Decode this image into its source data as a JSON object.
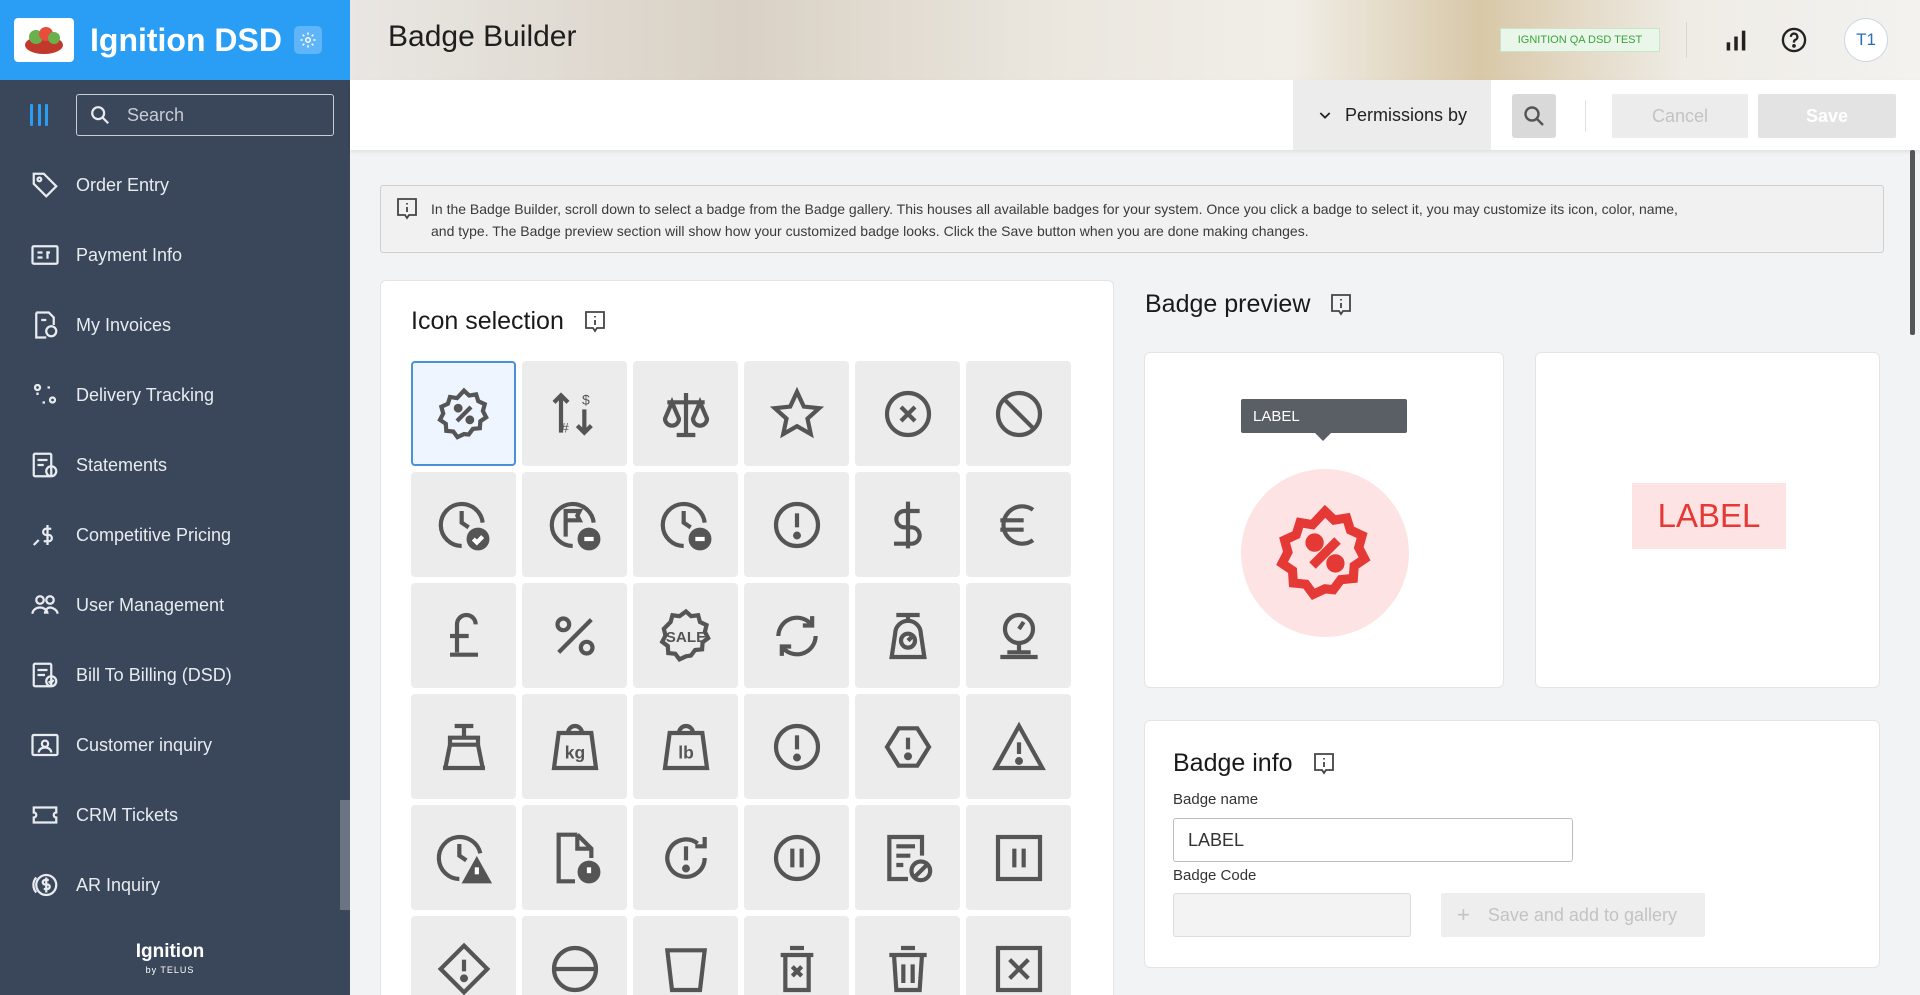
{
  "app": {
    "name": "Ignition DSD",
    "footer_brand": "Ignition",
    "footer_sub": "by TELUS"
  },
  "sidebar": {
    "search_placeholder": "Search",
    "items": [
      {
        "label": "Order Entry",
        "icon": "tag-icon"
      },
      {
        "label": "Payment Info",
        "icon": "payment-card-icon"
      },
      {
        "label": "My Invoices",
        "icon": "invoice-icon"
      },
      {
        "label": "Delivery Tracking",
        "icon": "route-pin-icon"
      },
      {
        "label": "Statements",
        "icon": "statement-icon"
      },
      {
        "label": "Competitive Pricing",
        "icon": "dollar-trend-icon"
      },
      {
        "label": "User Management",
        "icon": "users-icon"
      },
      {
        "label": "Bill To Billing (DSD)",
        "icon": "bill-check-icon"
      },
      {
        "label": "Customer inquiry",
        "icon": "customer-card-icon"
      },
      {
        "label": "CRM Tickets",
        "icon": "ticket-icon"
      },
      {
        "label": "AR Inquiry",
        "icon": "coin-icon"
      }
    ]
  },
  "header": {
    "title": "Badge Builder",
    "env_badge": "IGNITION QA DSD TEST",
    "avatar_initials": "T1"
  },
  "toolbar": {
    "permissions_label": "Permissions by",
    "cancel_label": "Cancel",
    "save_label": "Save"
  },
  "info_banner": {
    "line1": "In the Badge Builder, scroll down to select a badge from the Badge gallery. This houses all available badges for your system. Once you click a badge to select it, you may customize its icon, color, name,",
    "line2": "and type. The Badge preview section will show how your customized badge looks. Click the Save button when you are done making changes."
  },
  "icon_selection": {
    "title": "Icon selection",
    "icons": [
      "percent-badge-icon",
      "sort-price-icon",
      "scale-balance-icon",
      "star-icon",
      "circle-x-icon",
      "ban-icon",
      "clock-check-icon",
      "flag-minus-icon",
      "clock-minus-icon",
      "alert-circle-icon",
      "dollar-icon",
      "euro-icon",
      "pound-icon",
      "percent-icon",
      "sale-icon",
      "refresh-icon",
      "kitchen-scale-icon",
      "balance-scale-icon",
      "deli-scale-icon",
      "kg-weight-icon",
      "lb-weight-icon",
      "alert-circle-icon",
      "alert-octagon-icon",
      "alert-triangle-icon",
      "clock-alert-icon",
      "file-alert-icon",
      "history-alert-icon",
      "pause-circle-icon",
      "edit-block-icon",
      "pause-square-icon",
      "diamond-alert-icon",
      "minus-circle-icon",
      "cup-icon",
      "trash-x-icon",
      "trash-icon",
      "close-box-icon"
    ],
    "sale_text": "SALE",
    "kg_text": "kg",
    "lb_text": "lb"
  },
  "badge_preview": {
    "title": "Badge preview",
    "tooltip_label": "LABEL",
    "label_text": "LABEL",
    "color": "#e53935",
    "bg_color": "#fde3e3"
  },
  "badge_info": {
    "title": "Badge info",
    "name_label": "Badge name",
    "name_value": "LABEL",
    "code_label": "Badge Code",
    "code_value": "",
    "save_gallery_label": "Save and add to gallery"
  }
}
